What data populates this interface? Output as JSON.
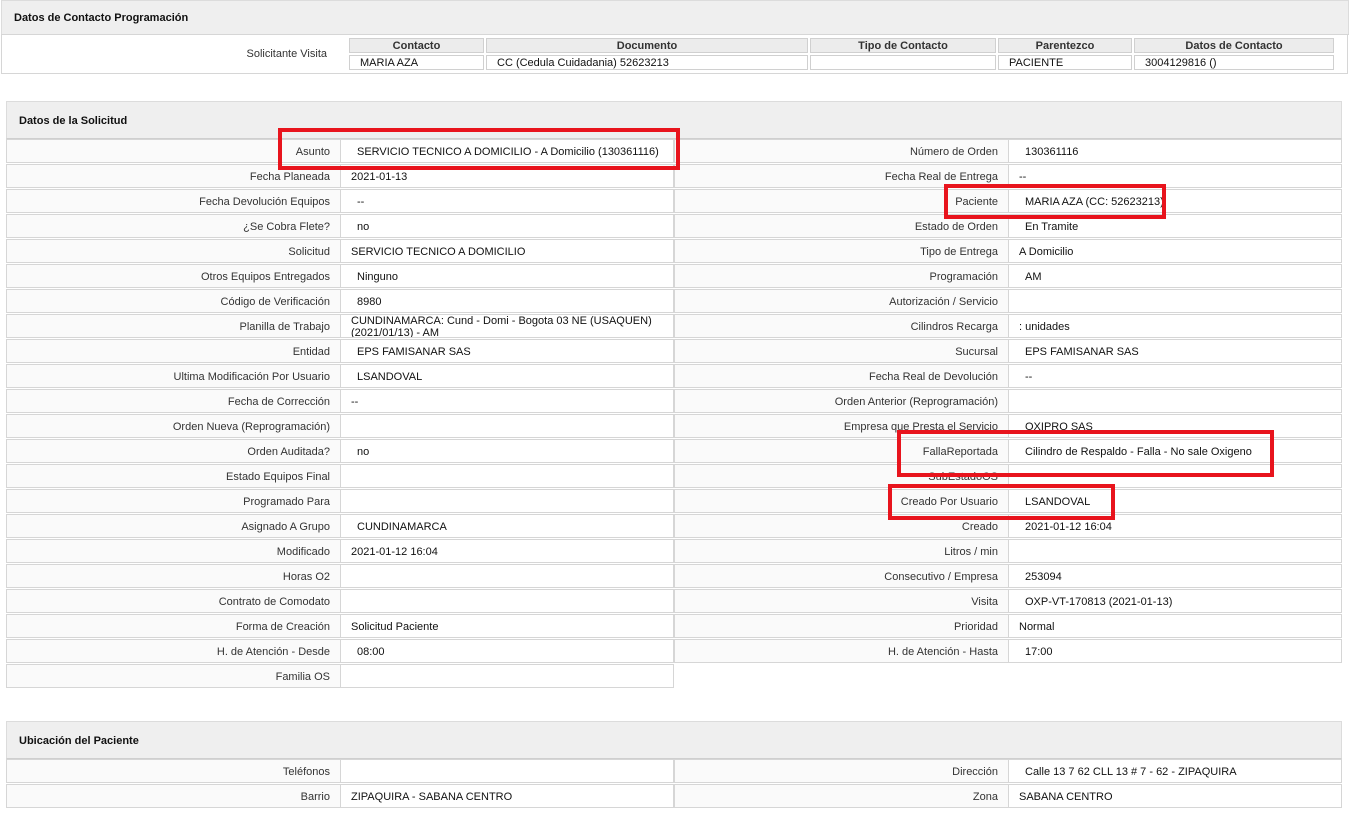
{
  "contacto": {
    "title": "Datos de Contacto Programación",
    "row_label": "Solicitante Visita",
    "headers": [
      "Contacto",
      "Documento",
      "Tipo de Contacto",
      "Parentezco",
      "Datos de Contacto"
    ],
    "row": [
      "MARIA AZA",
      "CC (Cedula Cuidadania) 52623213",
      "",
      "PACIENTE",
      "3004129816 ()"
    ]
  },
  "solicitud": {
    "title": "Datos de la Solicitud",
    "left": [
      {
        "label": "Asunto",
        "value": "SERVICIO TECNICO A DOMICILIO - A Domicilio (130361116)"
      },
      {
        "label": "Fecha Planeada",
        "value": "2021-01-13"
      },
      {
        "label": "Fecha Devolución Equipos",
        "value": "--"
      },
      {
        "label": "¿Se Cobra Flete?",
        "value": "no"
      },
      {
        "label": "Solicitud",
        "value": "SERVICIO TECNICO A DOMICILIO"
      },
      {
        "label": "Otros Equipos Entregados",
        "value": "Ninguno"
      },
      {
        "label": "Código de Verificación",
        "value": "8980"
      },
      {
        "label": "Planilla de Trabajo",
        "value": "CUNDINAMARCA: Cund - Domi - Bogota 03 NE (USAQUEN)",
        "value2": "(2021/01/13) - AM"
      },
      {
        "label": "Entidad",
        "value": "EPS FAMISANAR SAS"
      },
      {
        "label": "Ultima Modificación Por Usuario",
        "value": "LSANDOVAL"
      },
      {
        "label": "Fecha de Corrección",
        "value": "--"
      },
      {
        "label": "Orden Nueva (Reprogramación)",
        "value": ""
      },
      {
        "label": "Orden Auditada?",
        "value": "no"
      },
      {
        "label": "Estado Equipos Final",
        "value": ""
      },
      {
        "label": "Programado Para",
        "value": ""
      },
      {
        "label": "Asignado A Grupo",
        "value": "CUNDINAMARCA"
      },
      {
        "label": "Modificado",
        "value": "2021-01-12 16:04"
      },
      {
        "label": "Horas O2",
        "value": ""
      },
      {
        "label": "Contrato de Comodato",
        "value": ""
      },
      {
        "label": "Forma de Creación",
        "value": "Solicitud Paciente"
      },
      {
        "label": "H. de Atención - Desde",
        "value": "08:00"
      },
      {
        "label": "Familia OS",
        "value": ""
      }
    ],
    "right": [
      {
        "label": "Número de Orden",
        "value": "130361116"
      },
      {
        "label": "Fecha Real de Entrega",
        "value": "--"
      },
      {
        "label": "Paciente",
        "value": "MARIA AZA (CC: 52623213)"
      },
      {
        "label": "Estado de Orden",
        "value": "En Tramite"
      },
      {
        "label": "Tipo de Entrega",
        "value": "A Domicilio"
      },
      {
        "label": "Programación",
        "value": "AM"
      },
      {
        "label": "Autorización / Servicio",
        "value": ""
      },
      {
        "label": "Cilindros Recarga",
        "value": ": unidades"
      },
      {
        "label": "Sucursal",
        "value": "EPS FAMISANAR SAS"
      },
      {
        "label": "Fecha Real de Devolución",
        "value": "--"
      },
      {
        "label": "Orden Anterior (Reprogramación)",
        "value": ""
      },
      {
        "label": "Empresa que Presta el Servicio",
        "value": "OXIPRO SAS"
      },
      {
        "label": "FallaReportada",
        "value": "Cilindro de Respaldo - Falla - No sale Oxigeno"
      },
      {
        "label": "SubEstadoOS",
        "value": ""
      },
      {
        "label": "Creado Por Usuario",
        "value": "LSANDOVAL"
      },
      {
        "label": "Creado",
        "value": "2021-01-12 16:04"
      },
      {
        "label": "Litros / min",
        "value": ""
      },
      {
        "label": "Consecutivo / Empresa",
        "value": "253094"
      },
      {
        "label": "Visita",
        "value": "OXP-VT-170813 (2021-01-13)"
      },
      {
        "label": "Prioridad",
        "value": "Normal"
      },
      {
        "label": "H. de Atención - Hasta",
        "value": "17:00"
      }
    ]
  },
  "ubicacion": {
    "title": "Ubicación del Paciente",
    "left": [
      {
        "label": "Teléfonos",
        "value": ""
      },
      {
        "label": "Barrio",
        "value": "ZIPAQUIRA - SABANA CENTRO"
      }
    ],
    "right": [
      {
        "label": "Dirección",
        "value": "Calle 13 7 62 CLL 13 # 7 - 62 - ZIPAQUIRA"
      },
      {
        "label": "Zona",
        "value": "SABANA CENTRO"
      }
    ]
  },
  "highlight_color": "#e8141d"
}
